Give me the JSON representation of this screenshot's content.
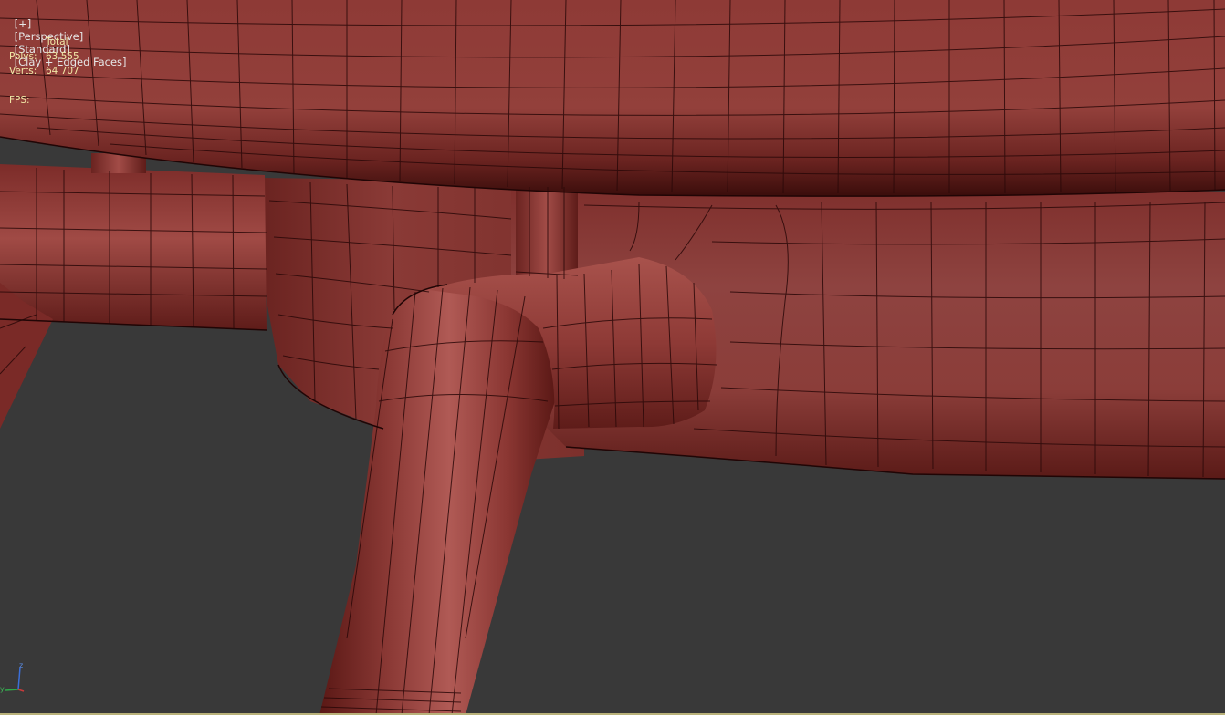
{
  "viewport": {
    "labels": [
      "[+]",
      "[Perspective]",
      "[Standard]",
      "[Clay + Edged Faces]"
    ],
    "stats": {
      "header": "Total",
      "rows": [
        {
          "label": "Polys:",
          "value": "63 555"
        },
        {
          "label": "Verts:",
          "value": "64 707"
        }
      ],
      "fps_label": "FPS:"
    },
    "axis": {
      "z": "z",
      "y": "y"
    }
  },
  "colors": {
    "background": "#393939",
    "clay": "#8a3632",
    "clay_dark": "#4a1412",
    "wire": "#2a0808",
    "stats_text": "#f2e9a8",
    "label_text": "#e6e6e6"
  }
}
